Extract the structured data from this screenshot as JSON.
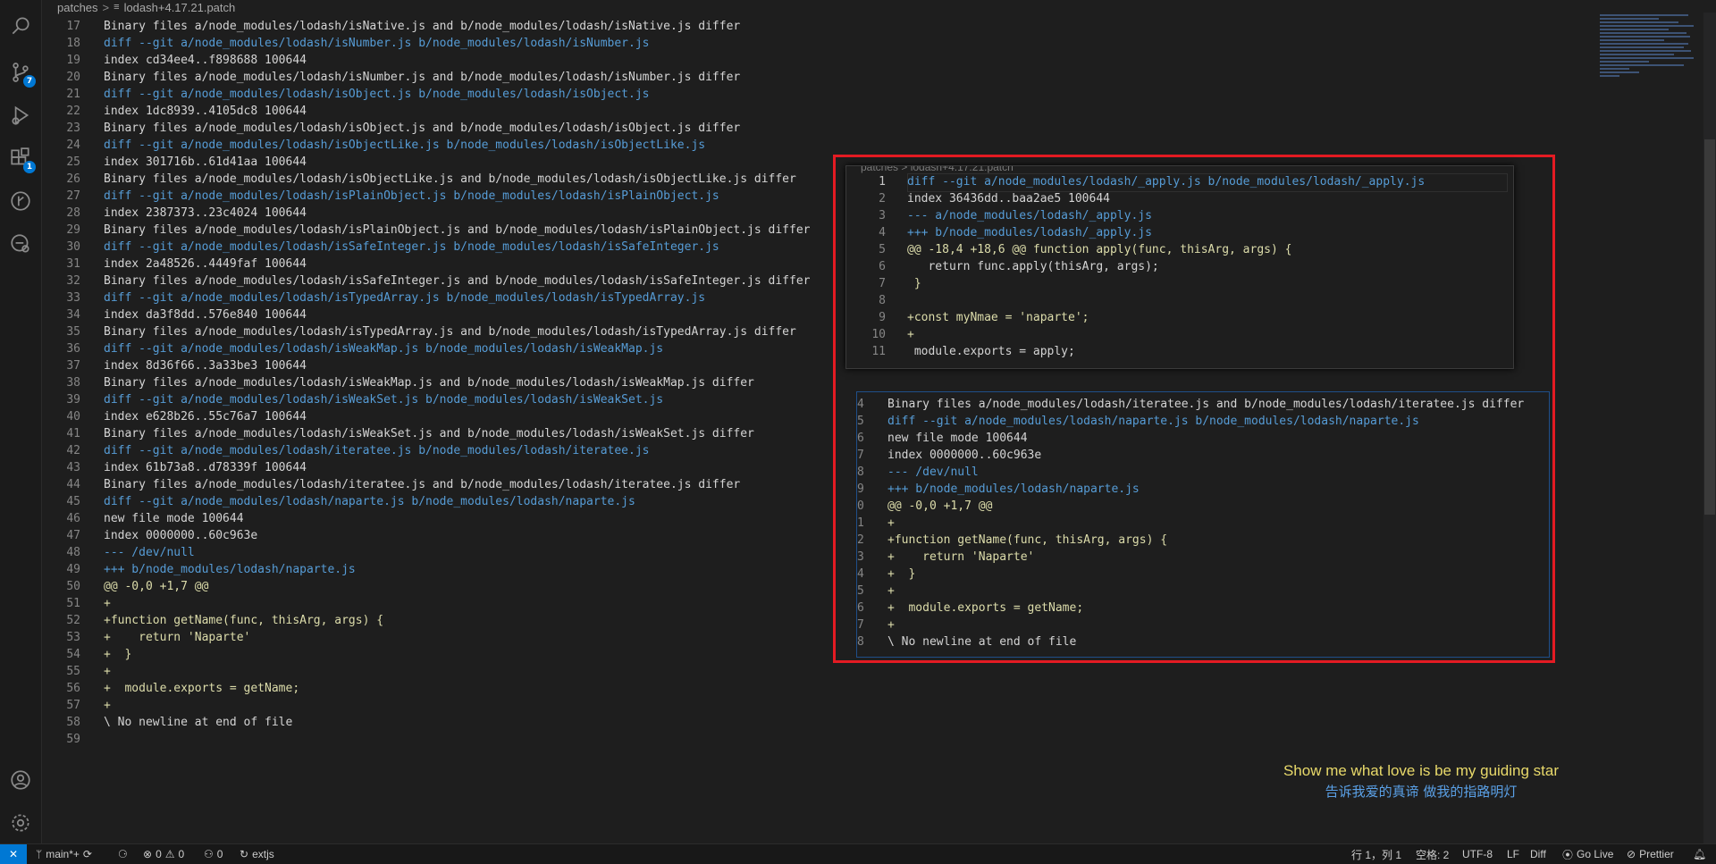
{
  "breadcrumbs": {
    "folder": "patches",
    "file": "lodash+4.17.21.patch"
  },
  "activity": {
    "scm_badge": "7",
    "extensions_badge": "1"
  },
  "editor_lines": [
    {
      "n": "17",
      "kind": "white",
      "text": "Binary files a/node_modules/lodash/isNative.js and b/node_modules/lodash/isNative.js differ"
    },
    {
      "n": "18",
      "kind": "blue",
      "text": "diff --git a/node_modules/lodash/isNumber.js b/node_modules/lodash/isNumber.js"
    },
    {
      "n": "19",
      "kind": "white",
      "text": "index cd34ee4..f898688 100644"
    },
    {
      "n": "20",
      "kind": "white",
      "text": "Binary files a/node_modules/lodash/isNumber.js and b/node_modules/lodash/isNumber.js differ"
    },
    {
      "n": "21",
      "kind": "blue",
      "text": "diff --git a/node_modules/lodash/isObject.js b/node_modules/lodash/isObject.js"
    },
    {
      "n": "22",
      "kind": "white",
      "text": "index 1dc8939..4105dc8 100644"
    },
    {
      "n": "23",
      "kind": "white",
      "text": "Binary files a/node_modules/lodash/isObject.js and b/node_modules/lodash/isObject.js differ"
    },
    {
      "n": "24",
      "kind": "blue",
      "text": "diff --git a/node_modules/lodash/isObjectLike.js b/node_modules/lodash/isObjectLike.js"
    },
    {
      "n": "25",
      "kind": "white",
      "text": "index 301716b..61d41aa 100644"
    },
    {
      "n": "26",
      "kind": "white",
      "text": "Binary files a/node_modules/lodash/isObjectLike.js and b/node_modules/lodash/isObjectLike.js differ"
    },
    {
      "n": "27",
      "kind": "blue",
      "text": "diff --git a/node_modules/lodash/isPlainObject.js b/node_modules/lodash/isPlainObject.js"
    },
    {
      "n": "28",
      "kind": "white",
      "text": "index 2387373..23c4024 100644"
    },
    {
      "n": "29",
      "kind": "white",
      "text": "Binary files a/node_modules/lodash/isPlainObject.js and b/node_modules/lodash/isPlainObject.js differ"
    },
    {
      "n": "30",
      "kind": "blue",
      "text": "diff --git a/node_modules/lodash/isSafeInteger.js b/node_modules/lodash/isSafeInteger.js"
    },
    {
      "n": "31",
      "kind": "white",
      "text": "index 2a48526..4449faf 100644"
    },
    {
      "n": "32",
      "kind": "white",
      "text": "Binary files a/node_modules/lodash/isSafeInteger.js and b/node_modules/lodash/isSafeInteger.js differ"
    },
    {
      "n": "33",
      "kind": "blue",
      "text": "diff --git a/node_modules/lodash/isTypedArray.js b/node_modules/lodash/isTypedArray.js"
    },
    {
      "n": "34",
      "kind": "white",
      "text": "index da3f8dd..576e840 100644"
    },
    {
      "n": "35",
      "kind": "white",
      "text": "Binary files a/node_modules/lodash/isTypedArray.js and b/node_modules/lodash/isTypedArray.js differ"
    },
    {
      "n": "36",
      "kind": "blue",
      "text": "diff --git a/node_modules/lodash/isWeakMap.js b/node_modules/lodash/isWeakMap.js"
    },
    {
      "n": "37",
      "kind": "white",
      "text": "index 8d36f66..3a33be3 100644"
    },
    {
      "n": "38",
      "kind": "white",
      "text": "Binary files a/node_modules/lodash/isWeakMap.js and b/node_modules/lodash/isWeakMap.js differ"
    },
    {
      "n": "39",
      "kind": "blue",
      "text": "diff --git a/node_modules/lodash/isWeakSet.js b/node_modules/lodash/isWeakSet.js"
    },
    {
      "n": "40",
      "kind": "white",
      "text": "index e628b26..55c76a7 100644"
    },
    {
      "n": "41",
      "kind": "white",
      "text": "Binary files a/node_modules/lodash/isWeakSet.js and b/node_modules/lodash/isWeakSet.js differ"
    },
    {
      "n": "42",
      "kind": "blue",
      "text": "diff --git a/node_modules/lodash/iteratee.js b/node_modules/lodash/iteratee.js"
    },
    {
      "n": "43",
      "kind": "white",
      "text": "index 61b73a8..d78339f 100644"
    },
    {
      "n": "44",
      "kind": "white",
      "text": "Binary files a/node_modules/lodash/iteratee.js and b/node_modules/lodash/iteratee.js differ"
    },
    {
      "n": "45",
      "kind": "blue",
      "text": "diff --git a/node_modules/lodash/naparte.js b/node_modules/lodash/naparte.js"
    },
    {
      "n": "46",
      "kind": "white",
      "text": "new file mode 100644"
    },
    {
      "n": "47",
      "kind": "white",
      "text": "index 0000000..60c963e"
    },
    {
      "n": "48",
      "kind": "blue",
      "text": "--- /dev/null"
    },
    {
      "n": "49",
      "kind": "blue",
      "text": "+++ b/node_modules/lodash/naparte.js"
    },
    {
      "n": "50",
      "kind": "yellow",
      "text": "@@ -0,0 +1,7 @@"
    },
    {
      "n": "51",
      "kind": "yellow",
      "text": "+"
    },
    {
      "n": "52",
      "kind": "yellow",
      "text": "+function getName(func, thisArg, args) {"
    },
    {
      "n": "53",
      "kind": "yellow",
      "text": "+    return 'Naparte'"
    },
    {
      "n": "54",
      "kind": "yellow",
      "text": "+  }"
    },
    {
      "n": "55",
      "kind": "yellow",
      "text": "+"
    },
    {
      "n": "56",
      "kind": "yellow",
      "text": "+  module.exports = getName;"
    },
    {
      "n": "57",
      "kind": "yellow",
      "text": "+"
    },
    {
      "n": "58",
      "kind": "white",
      "text": "\\ No newline at end of file"
    },
    {
      "n": "59",
      "kind": "white",
      "text": ""
    }
  ],
  "popup1": {
    "crumb": "patches > lodash+4.17.21.patch",
    "lines": [
      {
        "n": "1",
        "kind": "blue",
        "text": "diff --git a/node_modules/lodash/_apply.js b/node_modules/lodash/_apply.js"
      },
      {
        "n": "2",
        "kind": "white",
        "text": "index 36436dd..baa2ae5 100644"
      },
      {
        "n": "3",
        "kind": "blue",
        "text": "--- a/node_modules/lodash/_apply.js"
      },
      {
        "n": "4",
        "kind": "blue",
        "text": "+++ b/node_modules/lodash/_apply.js"
      },
      {
        "n": "5",
        "kind": "yellow",
        "text": "@@ -18,4 +18,6 @@ function apply(func, thisArg, args) {"
      },
      {
        "n": "6",
        "kind": "white",
        "text": "   return func.apply(thisArg, args);"
      },
      {
        "n": "7",
        "kind": "yellow",
        "text": " }"
      },
      {
        "n": "8",
        "kind": "white",
        "text": ""
      },
      {
        "n": "9",
        "kind": "yellow",
        "text": "+const myNmae = 'naparte';"
      },
      {
        "n": "10",
        "kind": "yellow",
        "text": "+"
      },
      {
        "n": "11",
        "kind": "white",
        "text": " module.exports = apply;"
      }
    ]
  },
  "popup2": {
    "lines": [
      {
        "n": "4",
        "kind": "white",
        "text": "Binary files a/node_modules/lodash/iteratee.js and b/node_modules/lodash/iteratee.js differ"
      },
      {
        "n": "5",
        "kind": "blue",
        "text": "diff --git a/node_modules/lodash/naparte.js b/node_modules/lodash/naparte.js"
      },
      {
        "n": "6",
        "kind": "white",
        "text": "new file mode 100644"
      },
      {
        "n": "7",
        "kind": "white",
        "text": "index 0000000..60c963e"
      },
      {
        "n": "8",
        "kind": "blue",
        "text": "--- /dev/null"
      },
      {
        "n": "9",
        "kind": "blue",
        "text": "+++ b/node_modules/lodash/naparte.js"
      },
      {
        "n": "0",
        "kind": "yellow",
        "text": "@@ -0,0 +1,7 @@"
      },
      {
        "n": "1",
        "kind": "yellow",
        "text": "+"
      },
      {
        "n": "2",
        "kind": "yellow",
        "text": "+function getName(func, thisArg, args) {"
      },
      {
        "n": "3",
        "kind": "yellow",
        "text": "+    return 'Naparte'"
      },
      {
        "n": "4",
        "kind": "yellow",
        "text": "+  }"
      },
      {
        "n": "5",
        "kind": "yellow",
        "text": "+"
      },
      {
        "n": "6",
        "kind": "yellow",
        "text": "+  module.exports = getName;"
      },
      {
        "n": "7",
        "kind": "yellow",
        "text": "+"
      },
      {
        "n": "8",
        "kind": "white",
        "text": "\\ No newline at end of file"
      }
    ]
  },
  "subtitles": {
    "en": "Show me what love is be my guiding star",
    "zh": "告诉我爱的真谛 做我的指路明灯"
  },
  "statusbar": {
    "branch": "main*+",
    "errors": "0",
    "warnings": "0",
    "ports": "0",
    "task": "extjs",
    "position": "行 1，列 1",
    "spaces": "空格: 2",
    "encoding": "UTF-8",
    "eol": "LF",
    "language": "Diff",
    "golive": "Go Live",
    "prettier": "Prettier"
  },
  "colors": {
    "blue": "#569cd6",
    "yellow": "#dcdcaa",
    "white": "#d4d4d4",
    "accent": "#0078d4",
    "highlight": "#e41b23"
  }
}
